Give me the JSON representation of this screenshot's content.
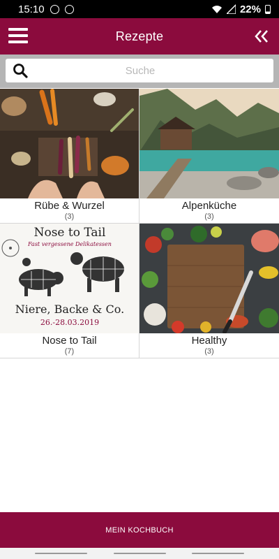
{
  "status_bar": {
    "time": "15:10",
    "battery": "22%"
  },
  "app_bar": {
    "title": "Rezepte"
  },
  "search": {
    "placeholder": "Suche",
    "value": ""
  },
  "categories": [
    {
      "name": "Rübe & Wurzel",
      "count": "(3)",
      "image": "root-vegetables-image"
    },
    {
      "name": "Alpenküche",
      "count": "(3)",
      "image": "alpine-lake-image"
    },
    {
      "name": "Nose to Tail",
      "count": "(7)",
      "image": "nose-to-tail-poster-image",
      "poster": {
        "title": "Nose to Tail",
        "subtitle": "Fast vergessene Delikatessen",
        "headline": "Niere, Backe & Co.",
        "dates": "26.-28.03.2019"
      }
    },
    {
      "name": "Healthy",
      "count": "(3)",
      "image": "healthy-vegetables-image"
    }
  ],
  "bottom_bar": {
    "label": "MEIN KOCHBUCH"
  },
  "colors": {
    "brand": "#8b0b3d",
    "search_bg": "#b5b5b5",
    "divider": "#d6d6d6"
  }
}
